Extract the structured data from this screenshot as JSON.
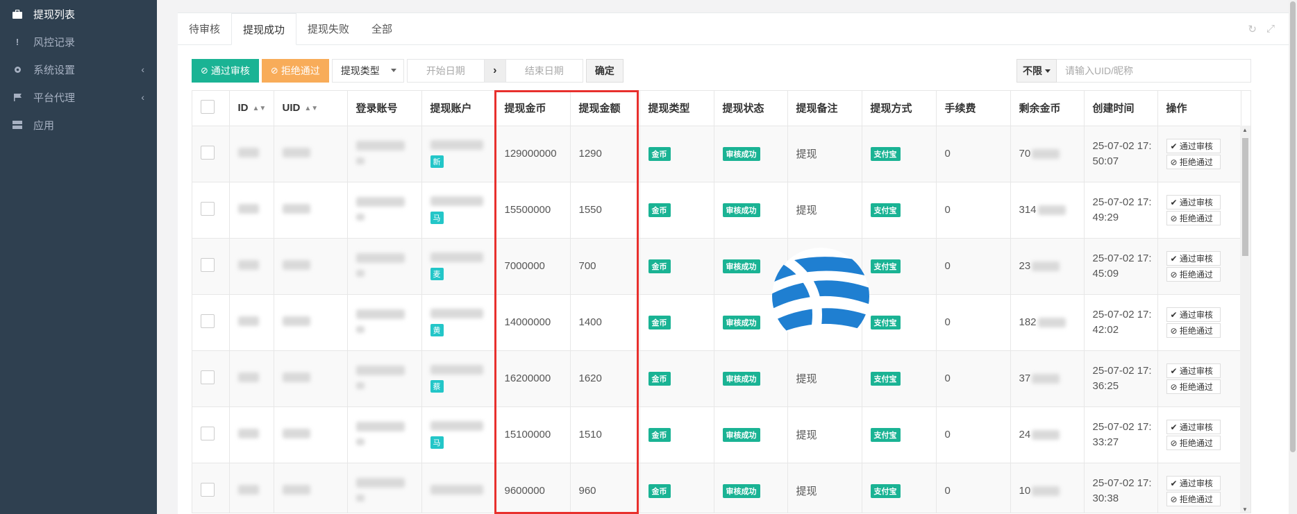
{
  "sidebar": {
    "items": [
      {
        "label": "提现列表",
        "icon": "briefcase-icon",
        "active": true
      },
      {
        "label": "风控记录",
        "icon": "exclamation-icon",
        "active": false
      },
      {
        "label": "系统设置",
        "icon": "gear-icon",
        "active": false,
        "arrow": "‹"
      },
      {
        "label": "平台代理",
        "icon": "flag-icon",
        "active": false,
        "arrow": "‹"
      },
      {
        "label": "应用",
        "icon": "grid-icon",
        "active": false
      }
    ]
  },
  "tabs": [
    "待审核",
    "提现成功",
    "提现失败",
    "全部"
  ],
  "active_tab": 1,
  "toolbar": {
    "approve_label": "通过审核",
    "reject_label": "拒绝通过",
    "type_select": "提现类型",
    "start_date_placeholder": "开始日期",
    "end_date_placeholder": "结束日期",
    "confirm_label": "确定",
    "search_scope": "不限",
    "search_placeholder": "请输入UID/昵称"
  },
  "table": {
    "headers": [
      "ID",
      "UID",
      "登录账号",
      "提现账户",
      "提现金币",
      "提现金额",
      "提现类型",
      "提现状态",
      "提现备注",
      "提现方式",
      "手续费",
      "剩余金币",
      "创建时间",
      "操作"
    ],
    "rows": [
      {
        "coins": "129000000",
        "amount": "1290",
        "type": "金币",
        "status": "审核成功",
        "note": "提现",
        "method": "支付宝",
        "fee": "0",
        "remain_prefix": "70",
        "acct_badge": "新",
        "time1": "25-07-02 17:",
        "time2": "50:07"
      },
      {
        "coins": "15500000",
        "amount": "1550",
        "type": "金币",
        "status": "审核成功",
        "note": "提现",
        "method": "支付宝",
        "fee": "0",
        "remain_prefix": "314",
        "acct_badge": "马",
        "time1": "25-07-02 17:",
        "time2": "49:29"
      },
      {
        "coins": "7000000",
        "amount": "700",
        "type": "金币",
        "status": "审核成功",
        "note": "提",
        "method": "支付宝",
        "fee": "0",
        "remain_prefix": "23",
        "acct_badge": "麦",
        "time1": "25-07-02 17:",
        "time2": "45:09"
      },
      {
        "coins": "14000000",
        "amount": "1400",
        "type": "金币",
        "status": "审核成功",
        "note": "提",
        "method": "支付宝",
        "fee": "0",
        "remain_prefix": "182",
        "acct_badge": "黄",
        "time1": "25-07-02 17:",
        "time2": "42:02"
      },
      {
        "coins": "16200000",
        "amount": "1620",
        "type": "金币",
        "status": "审核成功",
        "note": "提现",
        "method": "支付宝",
        "fee": "0",
        "remain_prefix": "37",
        "acct_badge": "蔡",
        "time1": "25-07-02 17:",
        "time2": "36:25"
      },
      {
        "coins": "15100000",
        "amount": "1510",
        "type": "金币",
        "status": "审核成功",
        "note": "提现",
        "method": "支付宝",
        "fee": "0",
        "remain_prefix": "24",
        "acct_badge": "马",
        "time1": "25-07-02 17:",
        "time2": "33:27"
      },
      {
        "coins": "9600000",
        "amount": "960",
        "type": "金币",
        "status": "审核成功",
        "note": "提现",
        "method": "支付宝",
        "fee": "0",
        "remain_prefix": "10",
        "acct_badge": "",
        "time1": "25-07-02 17:",
        "time2": "30:38"
      }
    ],
    "row_actions": {
      "approve": "通过审核",
      "reject": "拒绝通过"
    }
  },
  "colors": {
    "sidebar": "#2f4050",
    "green": "#1ab394",
    "orange": "#f8ac59",
    "highlight": "#e8302d"
  }
}
